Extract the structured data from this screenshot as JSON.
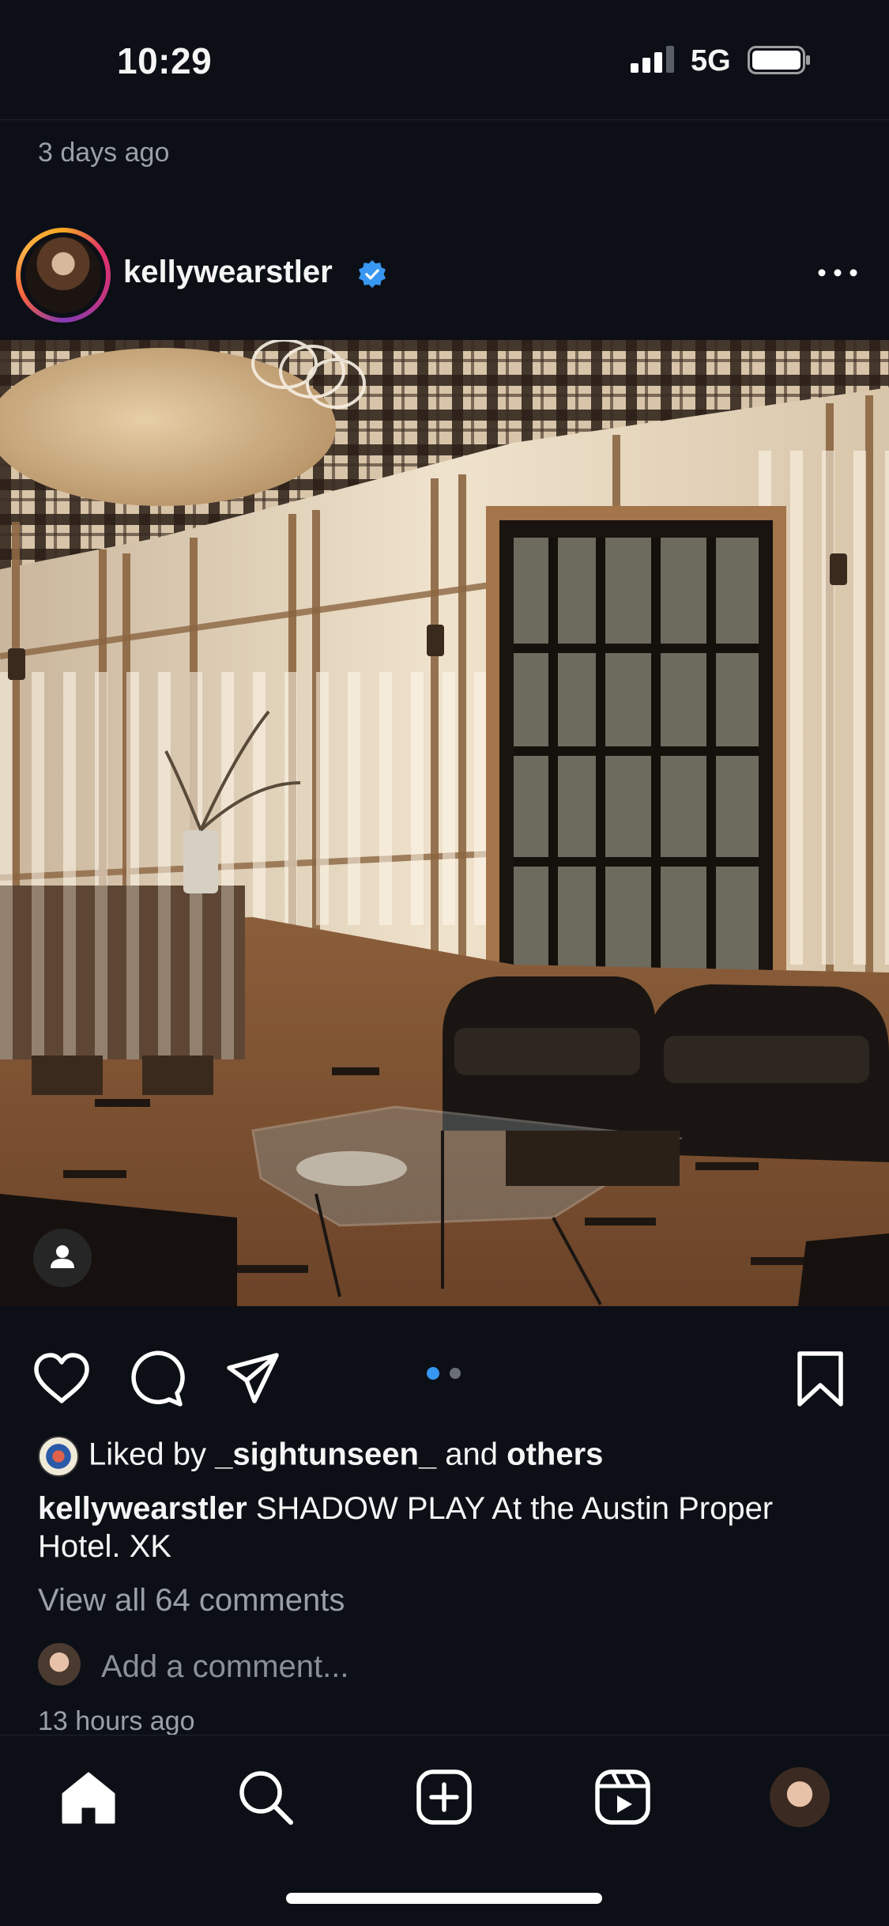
{
  "status_bar": {
    "time": "10:29",
    "network": "5G"
  },
  "previous_post": {
    "timestamp": "3 days ago"
  },
  "post": {
    "username": "kellywearstler",
    "liked_by_prefix": "Liked by ",
    "liked_by_user": "_sightunseen_",
    "liked_by_middle": " and ",
    "liked_by_others": "others",
    "caption_user": "kellywearstler",
    "caption_text": " SHADOW PLAY At the Austin Proper Hotel. XK",
    "view_comments": "View all 64 comments",
    "comment_placeholder": "Add a comment...",
    "timestamp": "13 hours ago",
    "carousel": {
      "total": 2,
      "current": 1
    }
  },
  "icons": {
    "actions": [
      "heart-icon",
      "comment-icon",
      "share-icon",
      "bookmark-icon"
    ],
    "tabs": [
      "home-icon",
      "search-icon",
      "create-icon",
      "reels-icon",
      "profile-avatar"
    ]
  },
  "colors": {
    "background": "#0c0f16",
    "accent_blue": "#3797f0",
    "verified_blue": "#3897f0"
  }
}
